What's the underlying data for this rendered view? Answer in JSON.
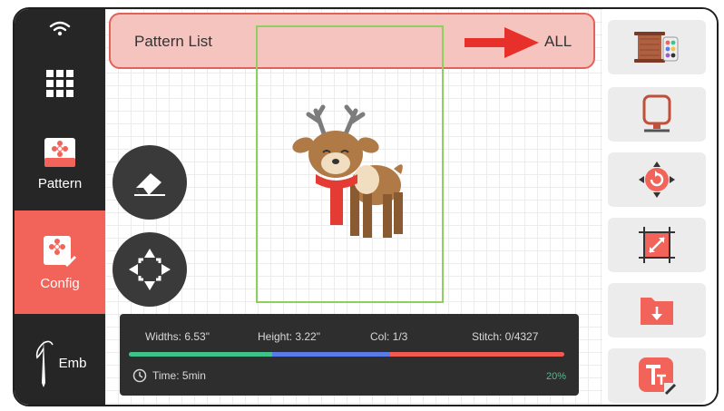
{
  "sidebar": {
    "icons": {
      "status": "wifi-icon",
      "menu": "grid-menu-icon"
    },
    "items": [
      {
        "label": "Pattern",
        "icon": "flower-card-icon"
      },
      {
        "label": "Config",
        "icon": "flower-card-pen-icon",
        "active": true
      },
      {
        "label": "Emb",
        "icon": "needle-thread-icon"
      }
    ]
  },
  "banner": {
    "title": "Pattern List",
    "action": "ALL",
    "arrow_icon": "arrow-right-icon"
  },
  "canvas": {
    "design_icon": "reindeer-design-icon",
    "tools": [
      "eraser-icon",
      "move-arrows-icon"
    ]
  },
  "info": {
    "width_text": "Widths: 6.53\"",
    "height_text": "Height: 3.22\"",
    "color_text": "Col: 1/3",
    "stitch_text": "Stitch: 0/4327",
    "time_text": "Time: 5min",
    "percent_text": "20%",
    "progress_segments": [
      {
        "color": "#3ec48a",
        "fraction": 0.33
      },
      {
        "color": "#5a7ae8",
        "fraction": 0.27
      },
      {
        "color": "#f05a50",
        "fraction": 0.4
      }
    ]
  },
  "right_panel": [
    "thread-spool-palette-icon",
    "hoop-frame-icon",
    "rotate-icon",
    "resize-icon",
    "folder-download-icon",
    "text-edit-icon"
  ],
  "colors": {
    "accent": "#f2645a",
    "sidebar": "#262626",
    "banner_bg": "#f6c4bf",
    "hoop": "#8fcf5f"
  }
}
